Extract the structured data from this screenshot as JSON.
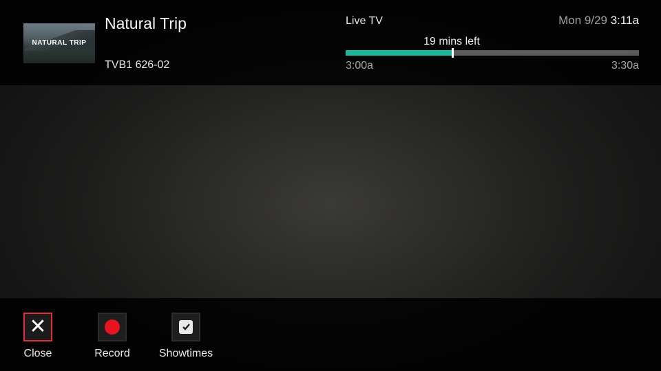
{
  "header": {
    "thumbnail_text": "NATURAL TRIP",
    "program_title": "Natural Trip",
    "channel": "TVB1 626-02",
    "source_label": "Live TV",
    "time_remaining": "19 mins left",
    "start_time": "3:00a",
    "end_time": "3:30a",
    "progress_fraction": 0.363,
    "date": "Mon 9/29",
    "clock_time": "3:11a"
  },
  "actions": [
    {
      "label": "Close",
      "icon": "close-icon",
      "focused": true
    },
    {
      "label": "Record",
      "icon": "record-icon",
      "focused": false
    },
    {
      "label": "Showtimes",
      "icon": "clock-icon",
      "focused": false
    }
  ],
  "colors": {
    "progress_fill": "#1cb89c",
    "focus_border": "#e0313b",
    "record_red": "#e8141f"
  }
}
